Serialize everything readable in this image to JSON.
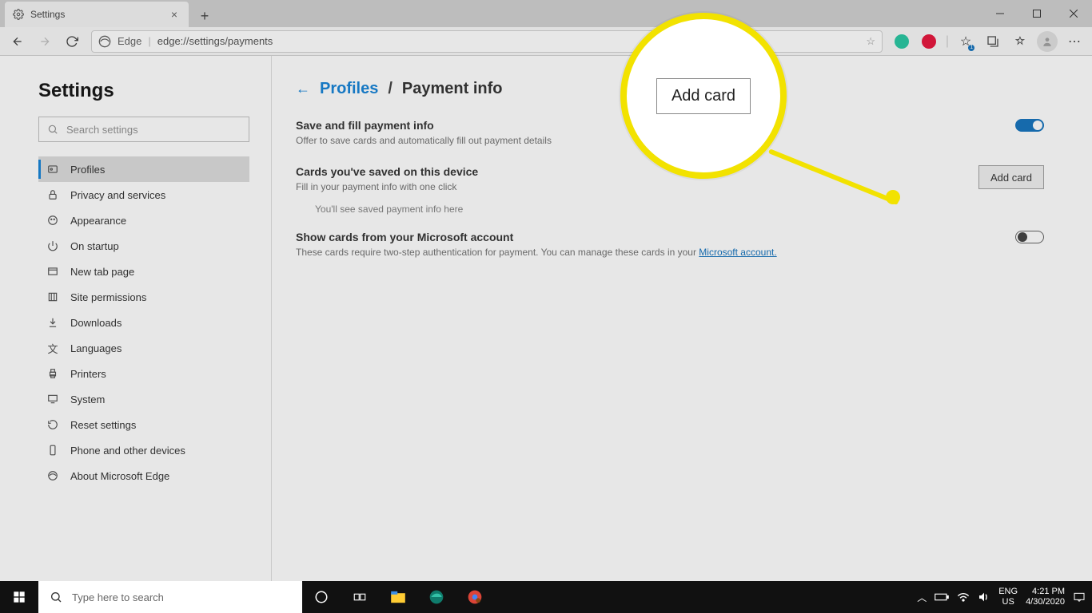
{
  "tab": {
    "title": "Settings"
  },
  "address": {
    "brand": "Edge",
    "url": "edge://settings/payments"
  },
  "settings": {
    "title": "Settings",
    "search_placeholder": "Search settings",
    "nav": [
      {
        "label": "Profiles"
      },
      {
        "label": "Privacy and services"
      },
      {
        "label": "Appearance"
      },
      {
        "label": "On startup"
      },
      {
        "label": "New tab page"
      },
      {
        "label": "Site permissions"
      },
      {
        "label": "Downloads"
      },
      {
        "label": "Languages"
      },
      {
        "label": "Printers"
      },
      {
        "label": "System"
      },
      {
        "label": "Reset settings"
      },
      {
        "label": "Phone and other devices"
      },
      {
        "label": "About Microsoft Edge"
      }
    ]
  },
  "crumb": {
    "root": "Profiles",
    "current": "Payment info"
  },
  "rows": {
    "save": {
      "title": "Save and fill payment info",
      "sub": "Offer to save cards and automatically fill out payment details"
    },
    "cards": {
      "title": "Cards you've saved on this device",
      "sub": "Fill in your payment info with one click",
      "button": "Add card",
      "empty": "You'll see saved payment info here"
    },
    "ms": {
      "title": "Show cards from your Microsoft account",
      "sub_a": "These cards require two-step authentication for payment. You can manage these cards in your ",
      "sub_link": "Microsoft account."
    }
  },
  "callout": {
    "label": "Add card"
  },
  "taskbar": {
    "search_placeholder": "Type here to search",
    "lang1": "ENG",
    "lang2": "US",
    "time": "4:21 PM",
    "date": "4/30/2020"
  }
}
